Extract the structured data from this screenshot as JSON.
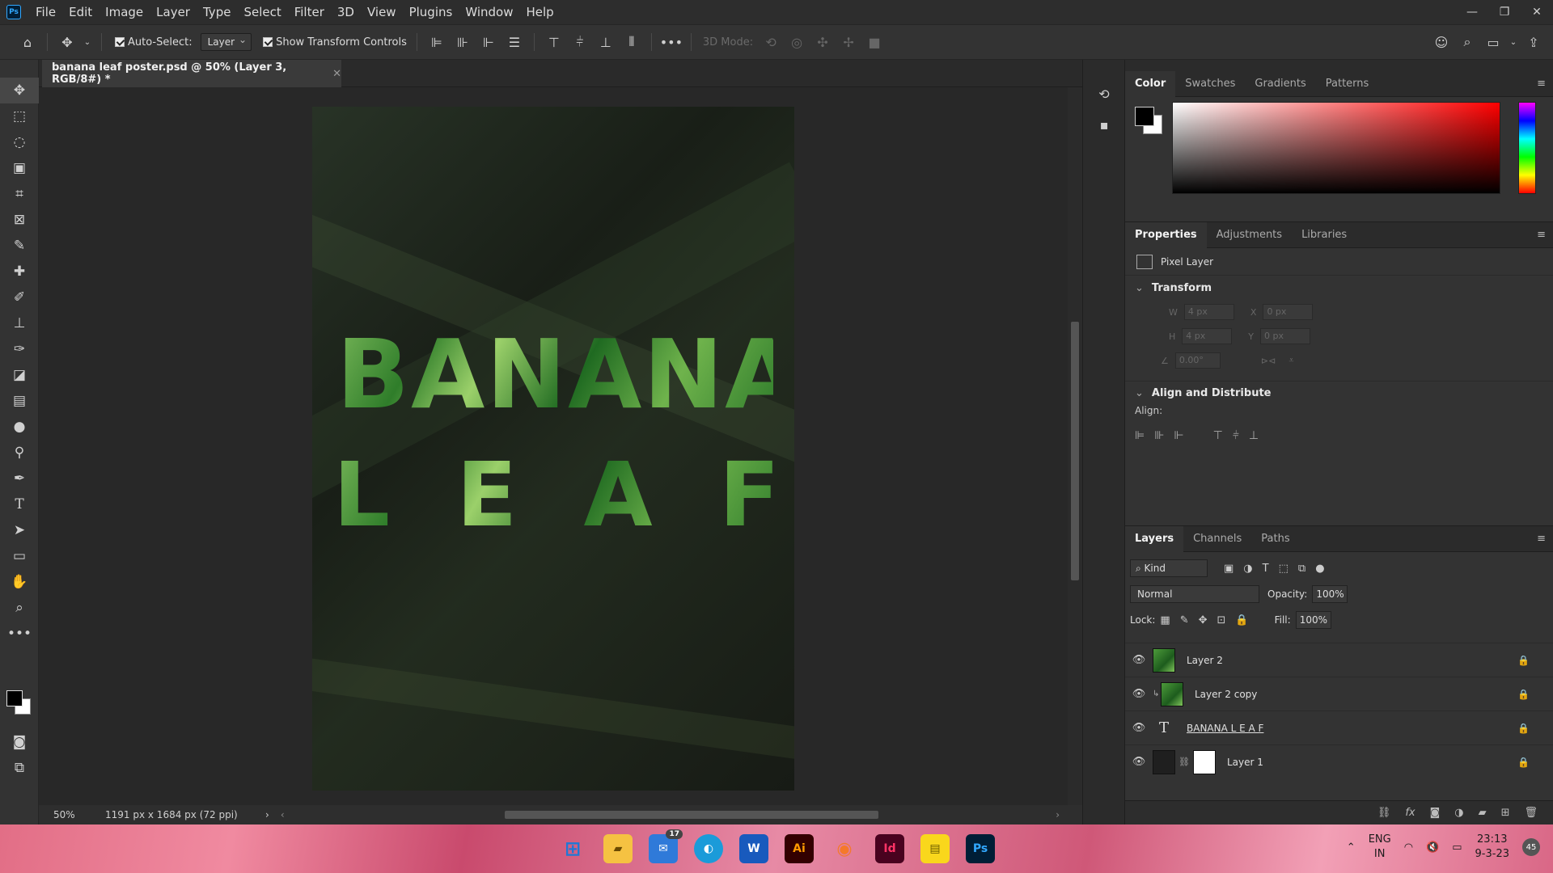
{
  "menu": {
    "items": [
      "File",
      "Edit",
      "Image",
      "Layer",
      "Type",
      "Select",
      "Filter",
      "3D",
      "View",
      "Plugins",
      "Window",
      "Help"
    ]
  },
  "options": {
    "auto_select_label": "Auto-Select:",
    "auto_select_value": "Layer",
    "show_transform_label": "Show Transform Controls",
    "mode_3d_label": "3D Mode:"
  },
  "document": {
    "tab_title": "banana leaf poster.psd @ 50% (Layer 3, RGB/8#) *",
    "zoom": "50%",
    "size_info": "1191 px x 1684 px (72 ppi)",
    "poster_line1": [
      "B",
      "A",
      "N",
      "A",
      "N",
      "A"
    ],
    "poster_line2": [
      "L",
      "E",
      "A",
      "F"
    ]
  },
  "color_panel": {
    "tabs": [
      "Color",
      "Swatches",
      "Gradients",
      "Patterns"
    ],
    "foreground": "#000000",
    "background": "#ffffff"
  },
  "properties": {
    "tabs": [
      "Properties",
      "Adjustments",
      "Libraries"
    ],
    "layer_type": "Pixel Layer",
    "transform_label": "Transform",
    "w_label": "W",
    "w_value": "4 px",
    "h_label": "H",
    "h_value": "4 px",
    "x_label": "X",
    "x_value": "0 px",
    "y_label": "Y",
    "y_value": "0 px",
    "angle_value": "0.00°",
    "align_section": "Align and Distribute",
    "align_label": "Align:"
  },
  "layers": {
    "tabs": [
      "Layers",
      "Channels",
      "Paths"
    ],
    "kind_label": "Kind",
    "blend_mode": "Normal",
    "opacity_label": "Opacity:",
    "opacity_value": "100%",
    "lock_label": "Lock:",
    "fill_label": "Fill:",
    "fill_value": "100%",
    "items": [
      {
        "name": "Layer 2"
      },
      {
        "name": "Layer 2 copy"
      },
      {
        "name": "BANANA L E A F"
      },
      {
        "name": "Layer 1"
      }
    ]
  },
  "taskbar": {
    "mail_badge": "17",
    "lang_line1": "ENG",
    "lang_line2": "IN",
    "time": "23:13",
    "date": "9-3-23",
    "notifications": "45"
  }
}
